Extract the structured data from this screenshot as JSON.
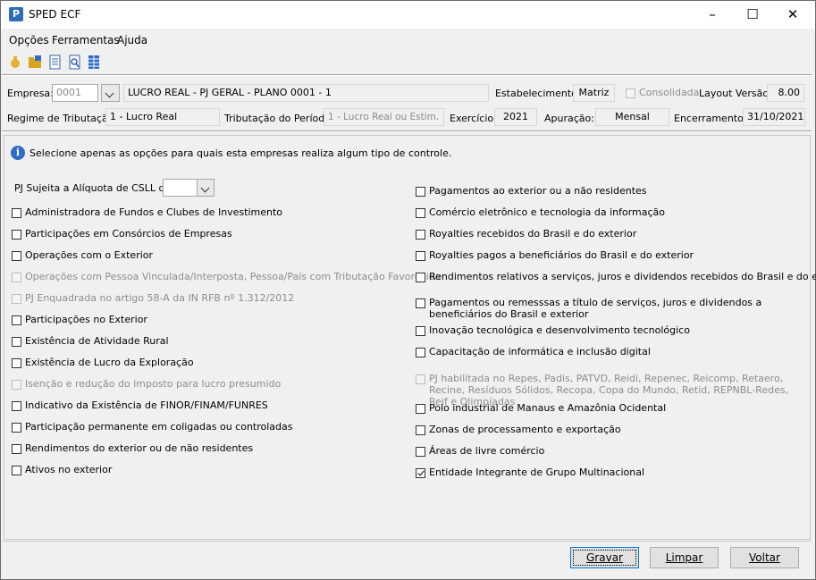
{
  "window": {
    "title": "SPED ECF",
    "app_icon_letter": "P",
    "controls": [
      "minimize-icon",
      "maximize-icon",
      "close-icon"
    ]
  },
  "menu": [
    "Opções",
    "Ferramentas",
    "Ajuda"
  ],
  "toolbar": [
    "hand-icon",
    "folder-icon",
    "document-icon",
    "search-document-icon",
    "grid-icon"
  ],
  "header": {
    "empresa_label": "Empresa:",
    "empresa_code": "0001",
    "empresa_name": "LUCRO REAL - PJ GERAL - PLANO 0001 - 1",
    "estabelecimento_label": "Estabelecimento:",
    "estabelecimento_value": "Matriz",
    "consolidada_label": "Consolidada",
    "layout_label": "Layout Versão:",
    "layout_value": "8.00",
    "regime_label": "Regime de Tributação:",
    "regime_value": "1 - Lucro Real",
    "tributacao_label": "Tributação do Período:",
    "tributacao_value": "1 - Lucro Real ou Estim.",
    "exercicio_label": "Exercício:",
    "exercicio_value": "2021",
    "apuracao_label": "Apuração:",
    "apuracao_value": "Mensal",
    "encerramento_label": "Encerramento:",
    "encerramento_value": "31/10/2021"
  },
  "info_text": "Selecione apenas as opções para quais esta  empresas realiza algum tipo de controle.",
  "csll_label": "PJ Sujeita a Alíquota de CSLL de:",
  "csll_value": "",
  "left_options": [
    {
      "label": "Administradora de Fundos e Clubes de Investimento",
      "checked": false,
      "disabled": false
    },
    {
      "label": "Participações em Consórcios de Empresas",
      "checked": false,
      "disabled": false
    },
    {
      "label": "Operações com o Exterior",
      "checked": false,
      "disabled": false
    },
    {
      "label": "Operações com Pessoa Vinculada/Interposta, Pessoa/País com Tributação Favorecida",
      "checked": false,
      "disabled": true
    },
    {
      "label": "PJ Enquadrada no artigo 58-A da IN RFB nº 1.312/2012",
      "checked": false,
      "disabled": true
    },
    {
      "label": "Participações no Exterior",
      "checked": false,
      "disabled": false
    },
    {
      "label": "Existência de Atividade Rural",
      "checked": false,
      "disabled": false
    },
    {
      "label": "Existência de Lucro da Exploração",
      "checked": false,
      "disabled": false
    },
    {
      "label": "Isenção e redução do imposto para lucro presumido",
      "checked": false,
      "disabled": true
    },
    {
      "label": "Indicativo da Existência de FINOR/FINAM/FUNRES",
      "checked": false,
      "disabled": false
    },
    {
      "label": "Participação permanente em coligadas ou controladas",
      "checked": false,
      "disabled": false
    },
    {
      "label": "Rendimentos do exterior ou de não residentes",
      "checked": false,
      "disabled": false
    },
    {
      "label": "Ativos no exterior",
      "checked": false,
      "disabled": false
    }
  ],
  "right_options": [
    {
      "label": "Pagamentos ao exterior ou a não residentes",
      "checked": false,
      "disabled": false
    },
    {
      "label": "Comércio eletrônico e tecnologia da informação",
      "checked": false,
      "disabled": false
    },
    {
      "label": "Royalties recebidos do Brasil e do exterior",
      "checked": false,
      "disabled": false
    },
    {
      "label": "Royalties pagos a beneficiários do Brasil e do exterior",
      "checked": false,
      "disabled": false
    },
    {
      "label": "Rendimentos relativos a serviços, juros e dividendos recebidos do Brasil e do exterior",
      "checked": false,
      "disabled": false
    },
    {
      "label": "Pagamentos ou remesssas a título de serviços, juros e dividendos a beneficiários do Brasil e exterior",
      "checked": false,
      "disabled": false
    },
    {
      "label": "Inovação tecnológica e desenvolvimento tecnológico",
      "checked": false,
      "disabled": false
    },
    {
      "label": "Capacitação de informática e inclusão digital",
      "checked": false,
      "disabled": false
    },
    {
      "label": "PJ habilitada no Repes, Padis, PATVD, Reidi, Repenec, Reicomp, Retaero, Recine, Resíduos Sólidos, Recopa, Copa do Mundo, Retid, REPNBL-Redes, Reif e Olimpíadas",
      "checked": false,
      "disabled": true
    },
    {
      "label": "Polo industrial de Manaus e Amazônia Ocidental",
      "checked": false,
      "disabled": false
    },
    {
      "label": "Zonas de processamento e exportação",
      "checked": false,
      "disabled": false
    },
    {
      "label": "Áreas de livre comércio",
      "checked": false,
      "disabled": false
    },
    {
      "label": "Entidade Integrante de Grupo Multinacional",
      "checked": true,
      "disabled": false
    }
  ],
  "buttons": {
    "gravar": "Gravar",
    "limpar": "Limpar",
    "voltar": "Voltar"
  }
}
